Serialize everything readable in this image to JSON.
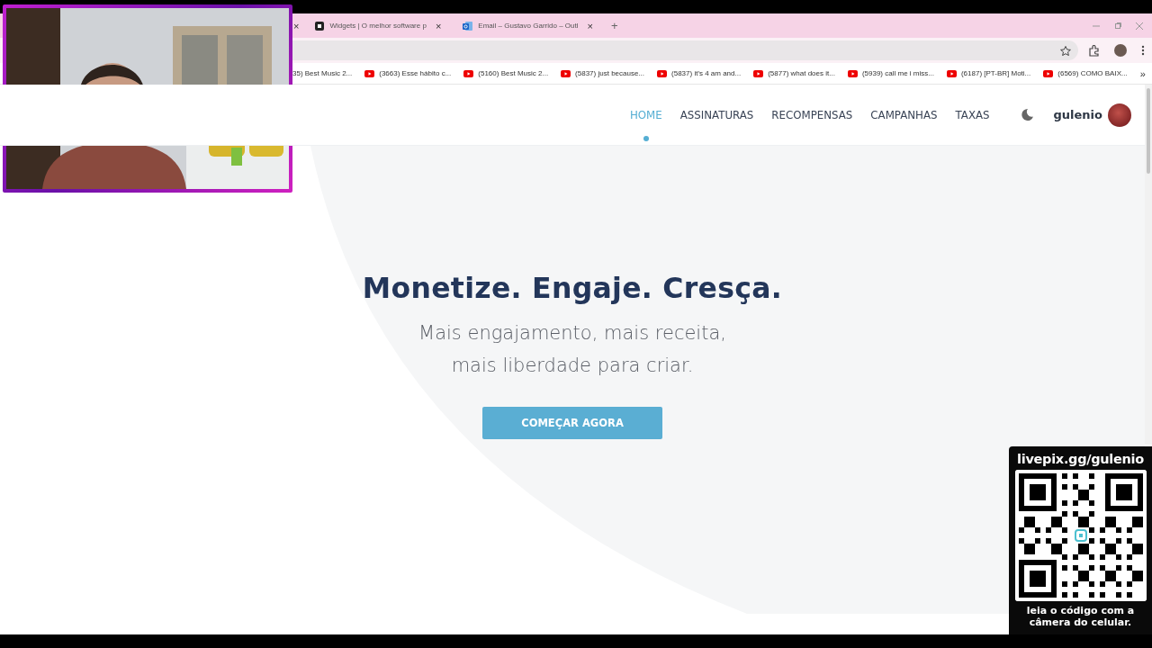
{
  "browser": {
    "hidden_tab_close": "×",
    "tabs": [
      {
        "title": "Widgets | O melhor software p",
        "close": "×",
        "selected": false
      },
      {
        "title": "Email – Gustavo Garrido – Outl",
        "close": "×",
        "selected": false
      }
    ],
    "new_tab": "+",
    "bookmarks": [
      "35) Best Music 2...",
      "(3663) Esse hábito c...",
      "(5160) Best Music 2...",
      "(5837) just because...",
      "(5837) it's 4 am and...",
      "(5877) what does it...",
      "(5939) call me i miss...",
      "(6187) [PT-BR] Moti...",
      "(6569) COMO BAIX..."
    ],
    "bookmarks_more": "»"
  },
  "site": {
    "nav": [
      {
        "label": "HOME",
        "selected": true
      },
      {
        "label": "ASSINATURAS",
        "selected": false
      },
      {
        "label": "RECOMPENSAS",
        "selected": false
      },
      {
        "label": "CAMPANHAS",
        "selected": false
      },
      {
        "label": "TAXAS",
        "selected": false
      }
    ],
    "user": "gulenio"
  },
  "hero": {
    "title": "Monetize. Engaje. Cresça.",
    "subtitle_lines": [
      "Mais engajamento, mais receita,",
      "mais liberdade para criar."
    ],
    "cta": "COMEÇAR AGORA"
  },
  "qr_overlay": {
    "url": "livepix.gg/gulenio",
    "caption_lines": [
      "leia o código com a",
      "câmera do celular."
    ]
  }
}
